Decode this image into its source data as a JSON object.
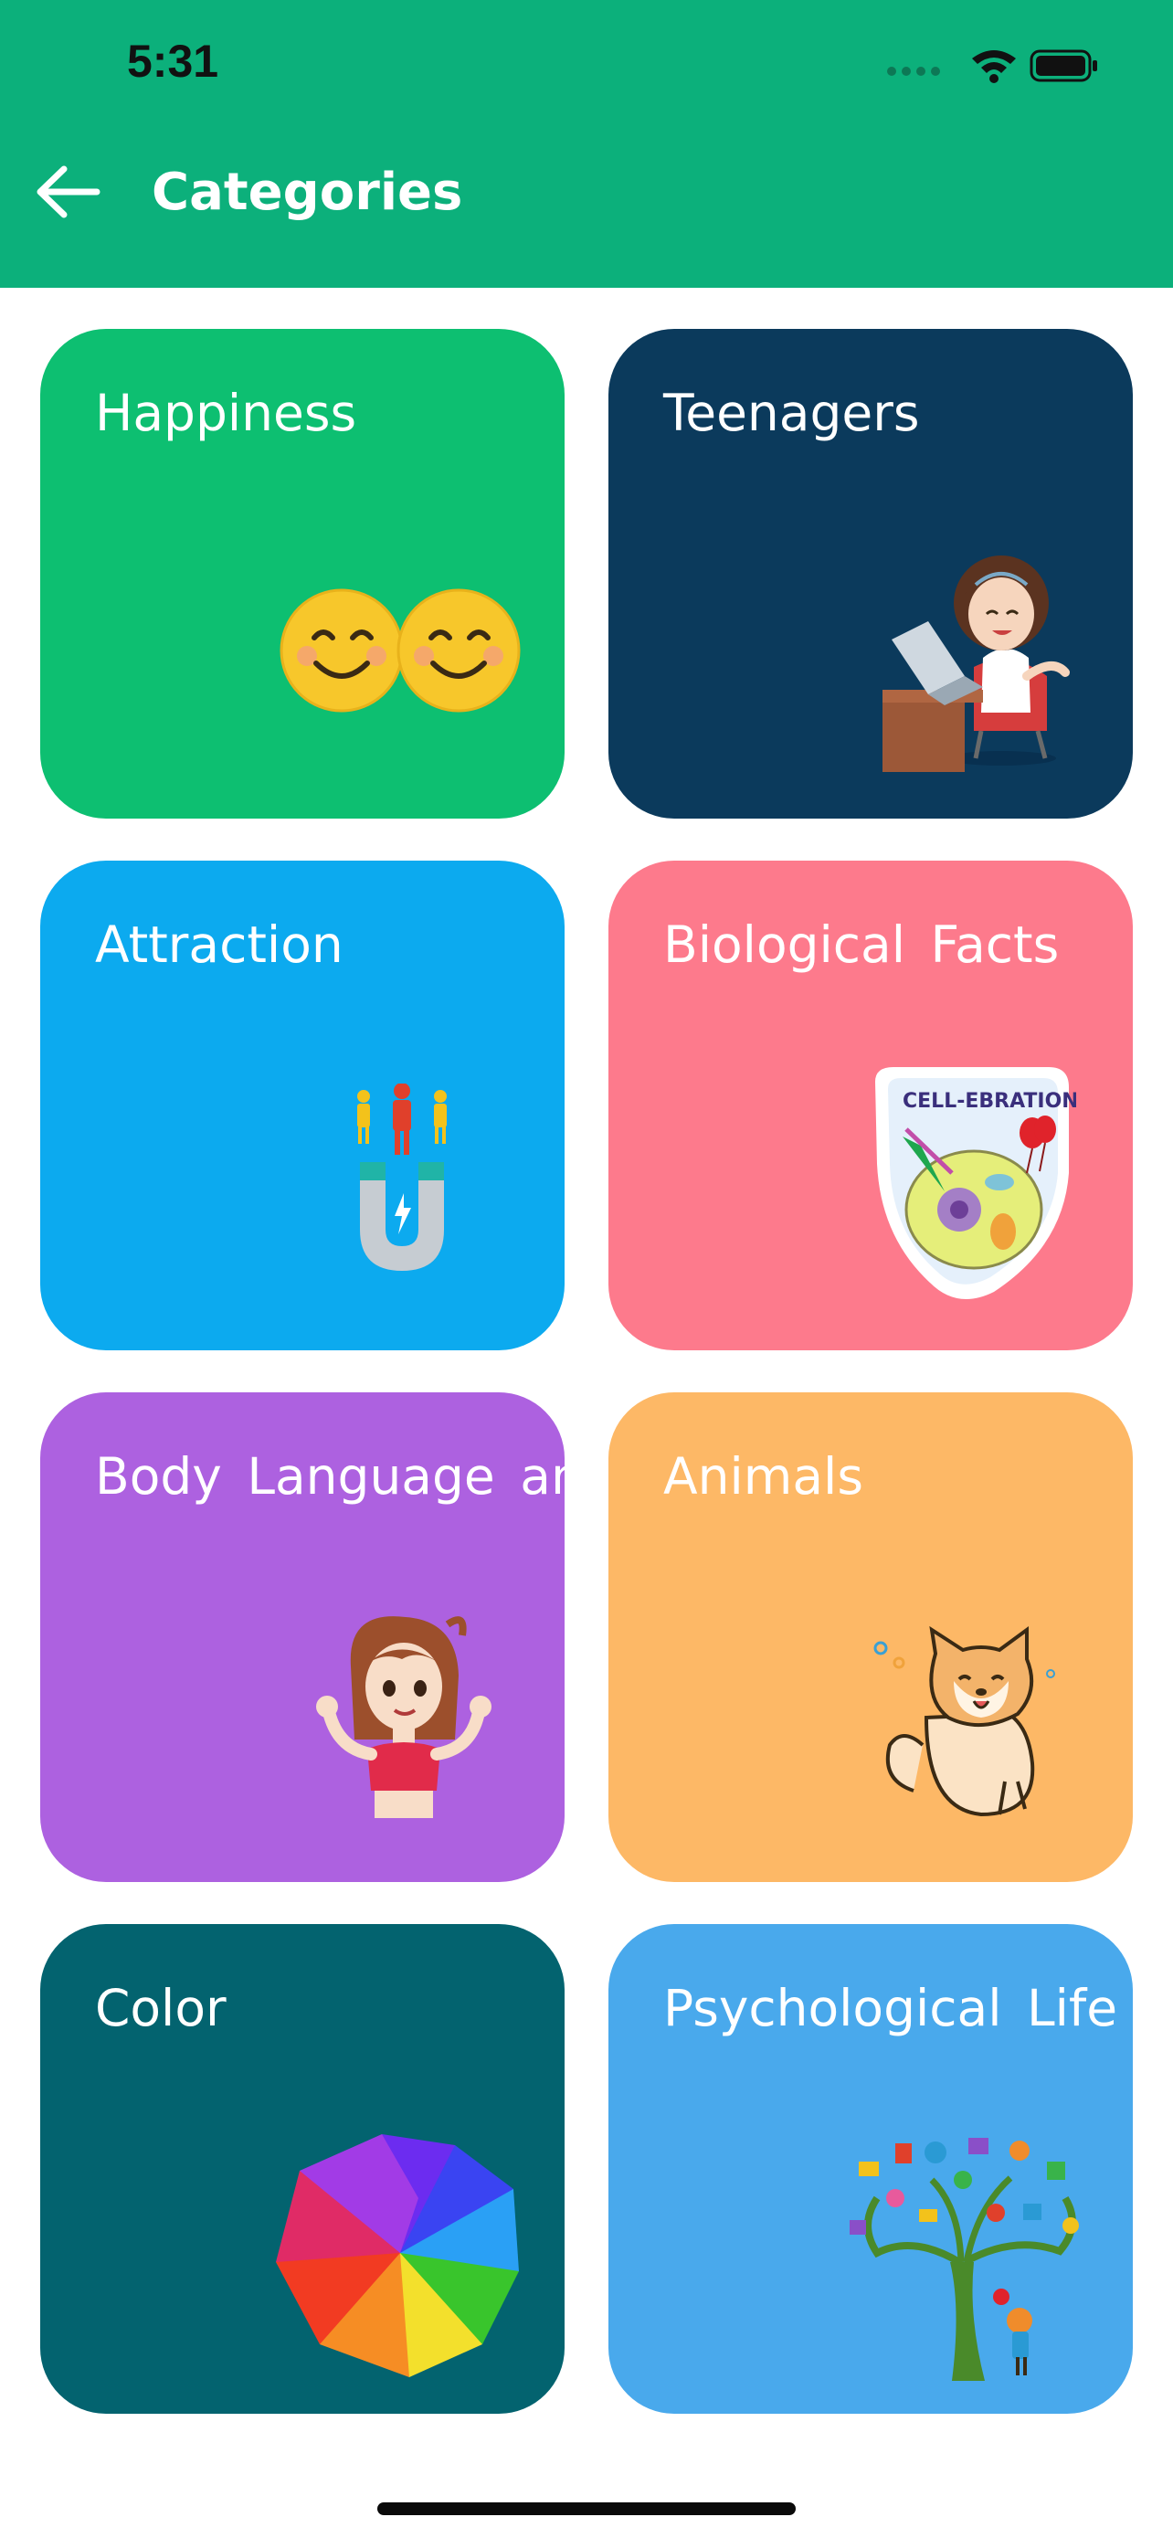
{
  "status_bar": {
    "time": "5:31"
  },
  "header": {
    "title": "Categories",
    "background": "#0cb07b"
  },
  "categories": [
    {
      "label": "Happiness",
      "color": "#0dbf71",
      "icon": "smiley-faces-icon"
    },
    {
      "label": "Teenagers",
      "color": "#0b3a5c",
      "icon": "girl-at-laptop-icon"
    },
    {
      "label": "Attraction",
      "color": "#0caaef",
      "icon": "magnet-people-icon"
    },
    {
      "label": "Biological Facts",
      "color": "#fd7a8c",
      "icon": "cell-ebration-sticker-icon"
    },
    {
      "label": "Body Language and",
      "color": "#ad61e0",
      "icon": "waving-girl-icon"
    },
    {
      "label": "Animals",
      "color": "#fdb866",
      "icon": "shiba-dog-icon"
    },
    {
      "label": "Color",
      "color": "#03636f",
      "icon": "color-wheel-icon"
    },
    {
      "label": "Psychological Life H",
      "color": "#49a9ec",
      "icon": "knowledge-tree-icon"
    }
  ],
  "sticker_text": "CELL-EBRATION"
}
